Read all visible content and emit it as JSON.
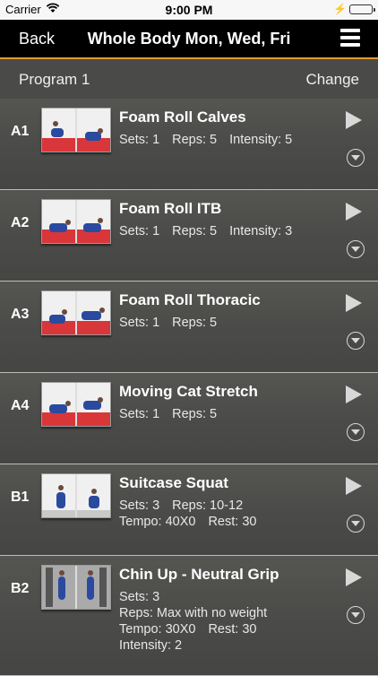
{
  "status_bar": {
    "carrier": "Carrier",
    "time": "9:00 PM",
    "battery_level": 1.0,
    "battery_color": "#33c64a",
    "icons": [
      "wifi-icon",
      "charging-icon",
      "battery-icon"
    ]
  },
  "nav": {
    "back_label": "Back",
    "title": "Whole Body Mon, Wed, Fri",
    "menu_icon": "hamburger-menu-icon",
    "accent_color": "#e39a2a"
  },
  "program": {
    "name": "Program 1",
    "change_label": "Change"
  },
  "exercises": [
    {
      "code": "A1",
      "name": "Foam Roll Calves",
      "lines": [
        [
          "Sets: 1",
          "Reps: 5",
          "Intensity: 5"
        ]
      ]
    },
    {
      "code": "A2",
      "name": "Foam Roll ITB",
      "lines": [
        [
          "Sets: 1",
          "Reps: 5",
          "Intensity: 3"
        ]
      ]
    },
    {
      "code": "A3",
      "name": "Foam Roll Thoracic",
      "lines": [
        [
          "Sets: 1",
          "Reps: 5"
        ]
      ]
    },
    {
      "code": "A4",
      "name": "Moving Cat Stretch",
      "lines": [
        [
          "Sets: 1",
          "Reps: 5"
        ]
      ]
    },
    {
      "code": "B1",
      "name": "Suitcase Squat",
      "lines": [
        [
          "Sets: 3",
          "Reps: 10-12"
        ],
        [
          "Tempo: 40X0",
          "Rest: 30"
        ]
      ]
    },
    {
      "code": "B2",
      "name": "Chin Up - Neutral Grip",
      "lines": [
        [
          "Sets: 3"
        ],
        [
          "Reps: Max with no weight"
        ],
        [
          "Tempo: 30X0",
          "Rest: 30"
        ],
        [
          "Intensity: 2"
        ]
      ]
    }
  ]
}
